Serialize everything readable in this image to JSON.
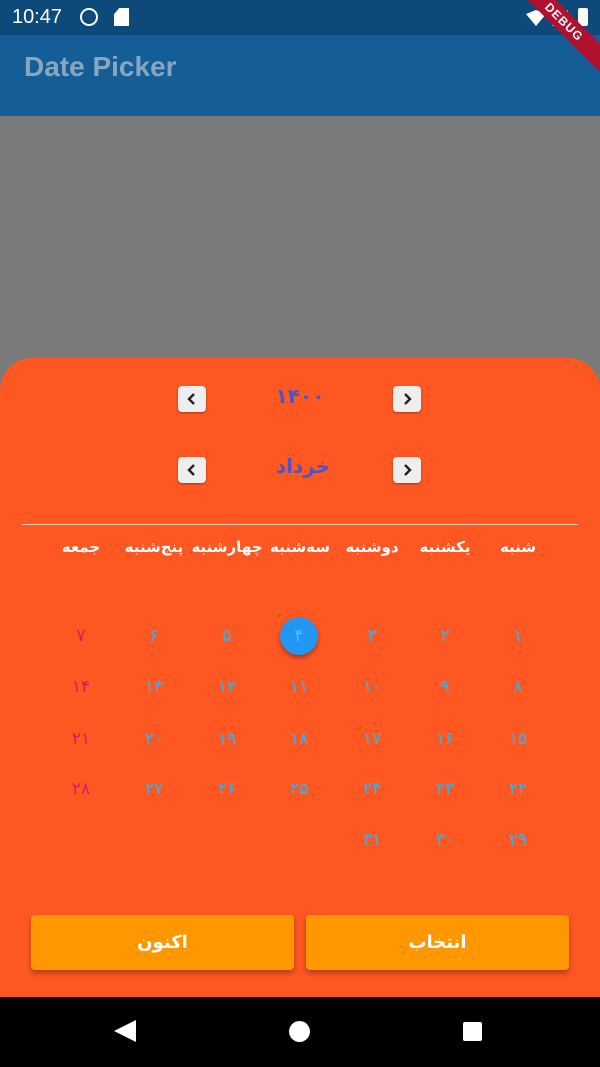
{
  "status_bar": {
    "time": "10:47"
  },
  "app_bar": {
    "title": "Date Picker",
    "debug_label": "DEBUG"
  },
  "picker": {
    "year": "۱۴۰۰",
    "month": "خرداد",
    "weekdays": [
      "شنبه",
      "یکشنبه",
      "دوشنبه",
      "سه‌شنبه",
      "چهارشنبه",
      "پنج‌شنبه",
      "جمعه"
    ],
    "weeks": [
      [
        "۱",
        "۲",
        "۳",
        "۴",
        "۵",
        "۶",
        "۷"
      ],
      [
        "۸",
        "۹",
        "۱۰",
        "۱۱",
        "۱۲",
        "۱۳",
        "۱۴"
      ],
      [
        "۱۵",
        "۱۶",
        "۱۷",
        "۱۸",
        "۱۹",
        "۲۰",
        "۲۱"
      ],
      [
        "۲۲",
        "۲۳",
        "۲۴",
        "۲۵",
        "۲۶",
        "۲۷",
        "۲۸"
      ],
      [
        "۲۹",
        "۳۰",
        "۳۱",
        "",
        "",
        "",
        ""
      ]
    ],
    "selected_day": "۴",
    "select_label": "انتخاب",
    "now_label": "اکنون"
  },
  "colors": {
    "sheet": "#ff5722",
    "button": "#ff9800",
    "day": "#29b6f6",
    "friday": "#d81b60",
    "selected": "#2196f3",
    "header_text": "#4a56c8"
  },
  "icons": {
    "year_prev": "chevron-left-icon",
    "year_next": "chevron-right-icon",
    "month_prev": "chevron-left-icon",
    "month_next": "chevron-right-icon"
  }
}
